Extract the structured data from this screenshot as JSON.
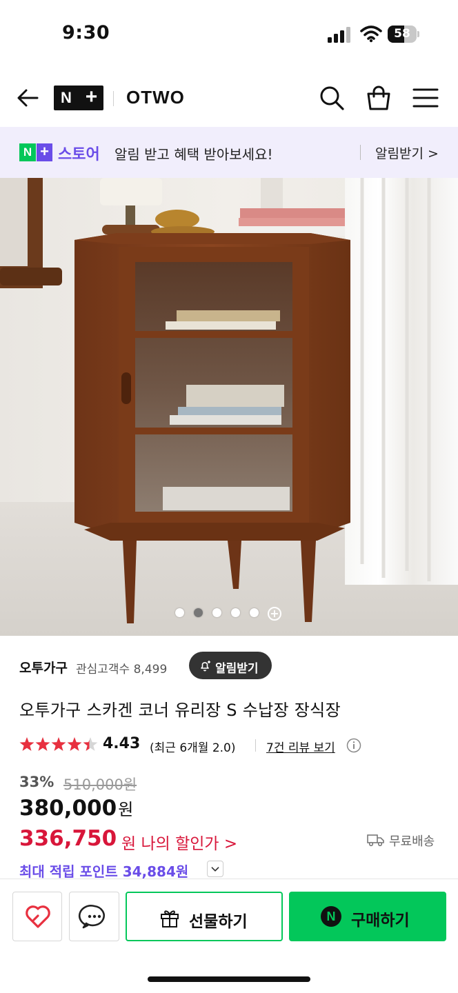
{
  "status_bar": {
    "time": "9:30",
    "battery": "58",
    "battery_level": 0.58
  },
  "header": {
    "store_name": "OTWO",
    "logo_letter": "N",
    "logo_plus": "+",
    "icons": [
      "back-arrow-icon",
      "search-icon",
      "shopping-bag-icon",
      "menu-icon"
    ]
  },
  "banner": {
    "logo_n": "N",
    "logo_plus": "+",
    "brand": "스토어",
    "text": "알림 받고 혜택 받아보세요!",
    "link": "알림받기 >"
  },
  "carousel": {
    "total_dots": 5,
    "active_index": 1,
    "more_icon": "+"
  },
  "store": {
    "name": "오투가구",
    "fans": "관심고객수 8,499",
    "favorite_button": "알림받기"
  },
  "product": {
    "title": "오투가구 스카겐 코너 유리장 S 수납장 장식장",
    "rating": "4.43",
    "rating_stars": 4.43,
    "rating_recent": "(최근 6개월 2.0)",
    "review_link": "7건 리뷰 보기"
  },
  "price": {
    "discount_rate": "33%",
    "original": "510,000원",
    "sale": "380,000",
    "sale_unit": "원",
    "my_price": "336,750",
    "my_price_label": "원 나의 할인가 >",
    "shipping": "무료배송",
    "points": "최대 적립 포인트 34,884원"
  },
  "bottom_bar": {
    "gift_label": "선물하기",
    "buy_label": "구매하기",
    "buy_badge": "N",
    "colors": {
      "accent": "#03c75a",
      "heart": "#e8303f",
      "discount": "#d8163a",
      "brand_purple": "#6a4de8"
    }
  }
}
